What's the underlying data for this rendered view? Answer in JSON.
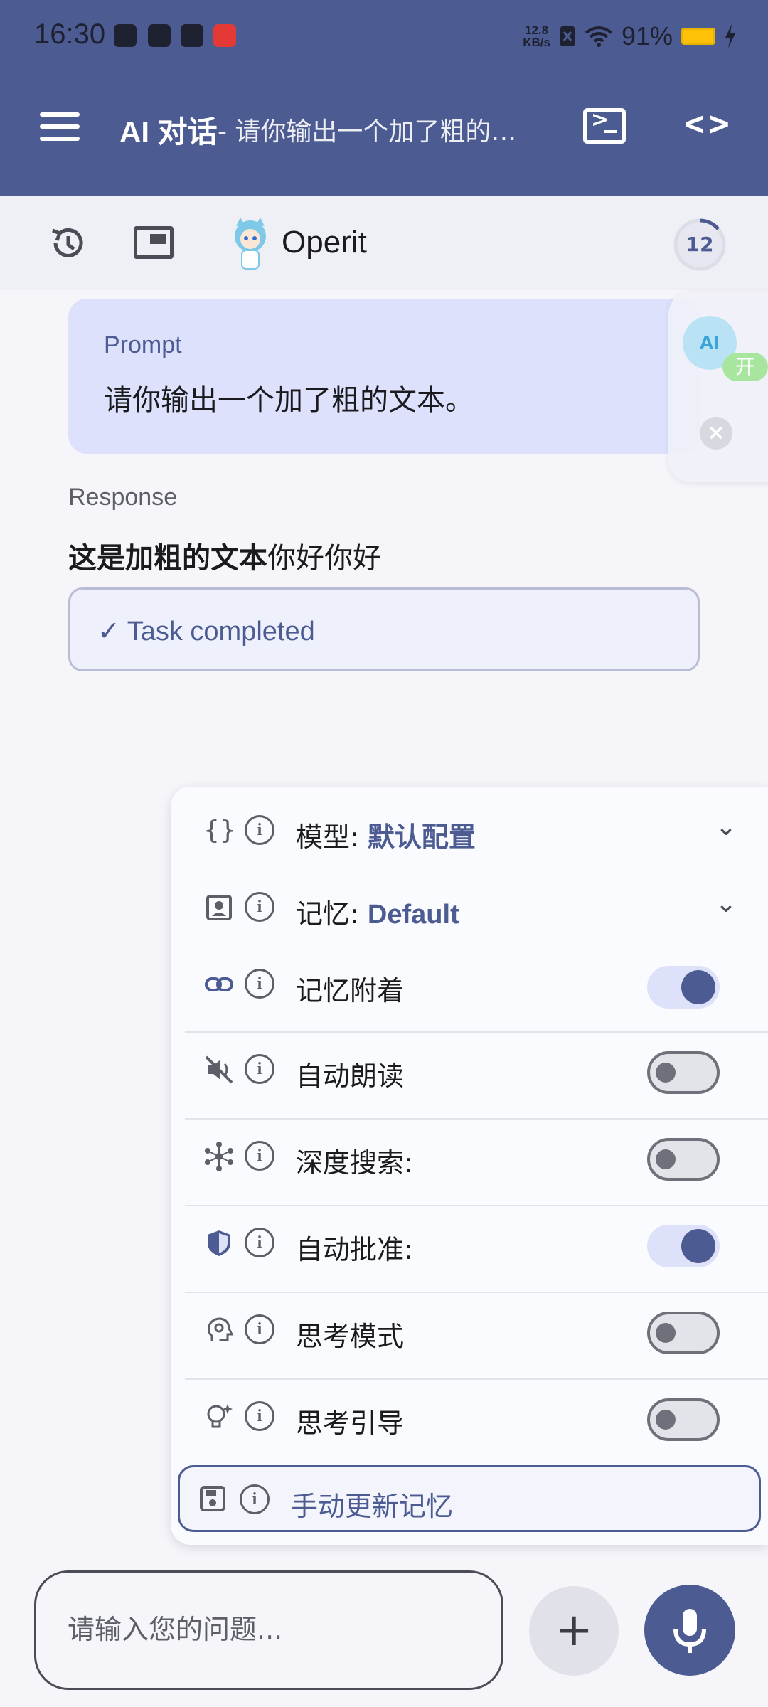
{
  "status_bar": {
    "time": "16:30",
    "net_speed_value": "12.8",
    "net_speed_unit": "KB/s",
    "battery": "91%"
  },
  "app_bar": {
    "title": "AI 对话",
    "subtitle": "- 请你输出一个加了粗的…"
  },
  "toolbar": {
    "model_name": "Operit",
    "context_count": "12"
  },
  "chat": {
    "prompt_label": "Prompt",
    "prompt_text": "请你输出一个加了粗的文本。",
    "response_label": "Response",
    "response_bold": "这是加粗的文本",
    "response_rest": "你好你好",
    "task_status": "✓ Task completed"
  },
  "floating": {
    "ai_label": "AI",
    "on_label": "开"
  },
  "settings_panel": {
    "model_label": "模型:",
    "model_value": "默认配置",
    "memory_label": "记忆:",
    "memory_value": "Default",
    "memory_attach": "记忆附着",
    "memory_attach_on": true,
    "auto_read": "自动朗读",
    "auto_read_on": false,
    "deep_search": "深度搜索:",
    "deep_search_on": false,
    "auto_approve": "自动批准:",
    "auto_approve_on": true,
    "thinking_mode": "思考模式",
    "thinking_mode_on": false,
    "thinking_guide": "思考引导",
    "thinking_guide_on": false,
    "manual_update": "手动更新记忆"
  },
  "input": {
    "placeholder": "请输入您的问题..."
  },
  "colors": {
    "primary": "#4c5b91",
    "prompt_bg": "#dee1fb",
    "toggle_on_track": "#dde1f9"
  }
}
